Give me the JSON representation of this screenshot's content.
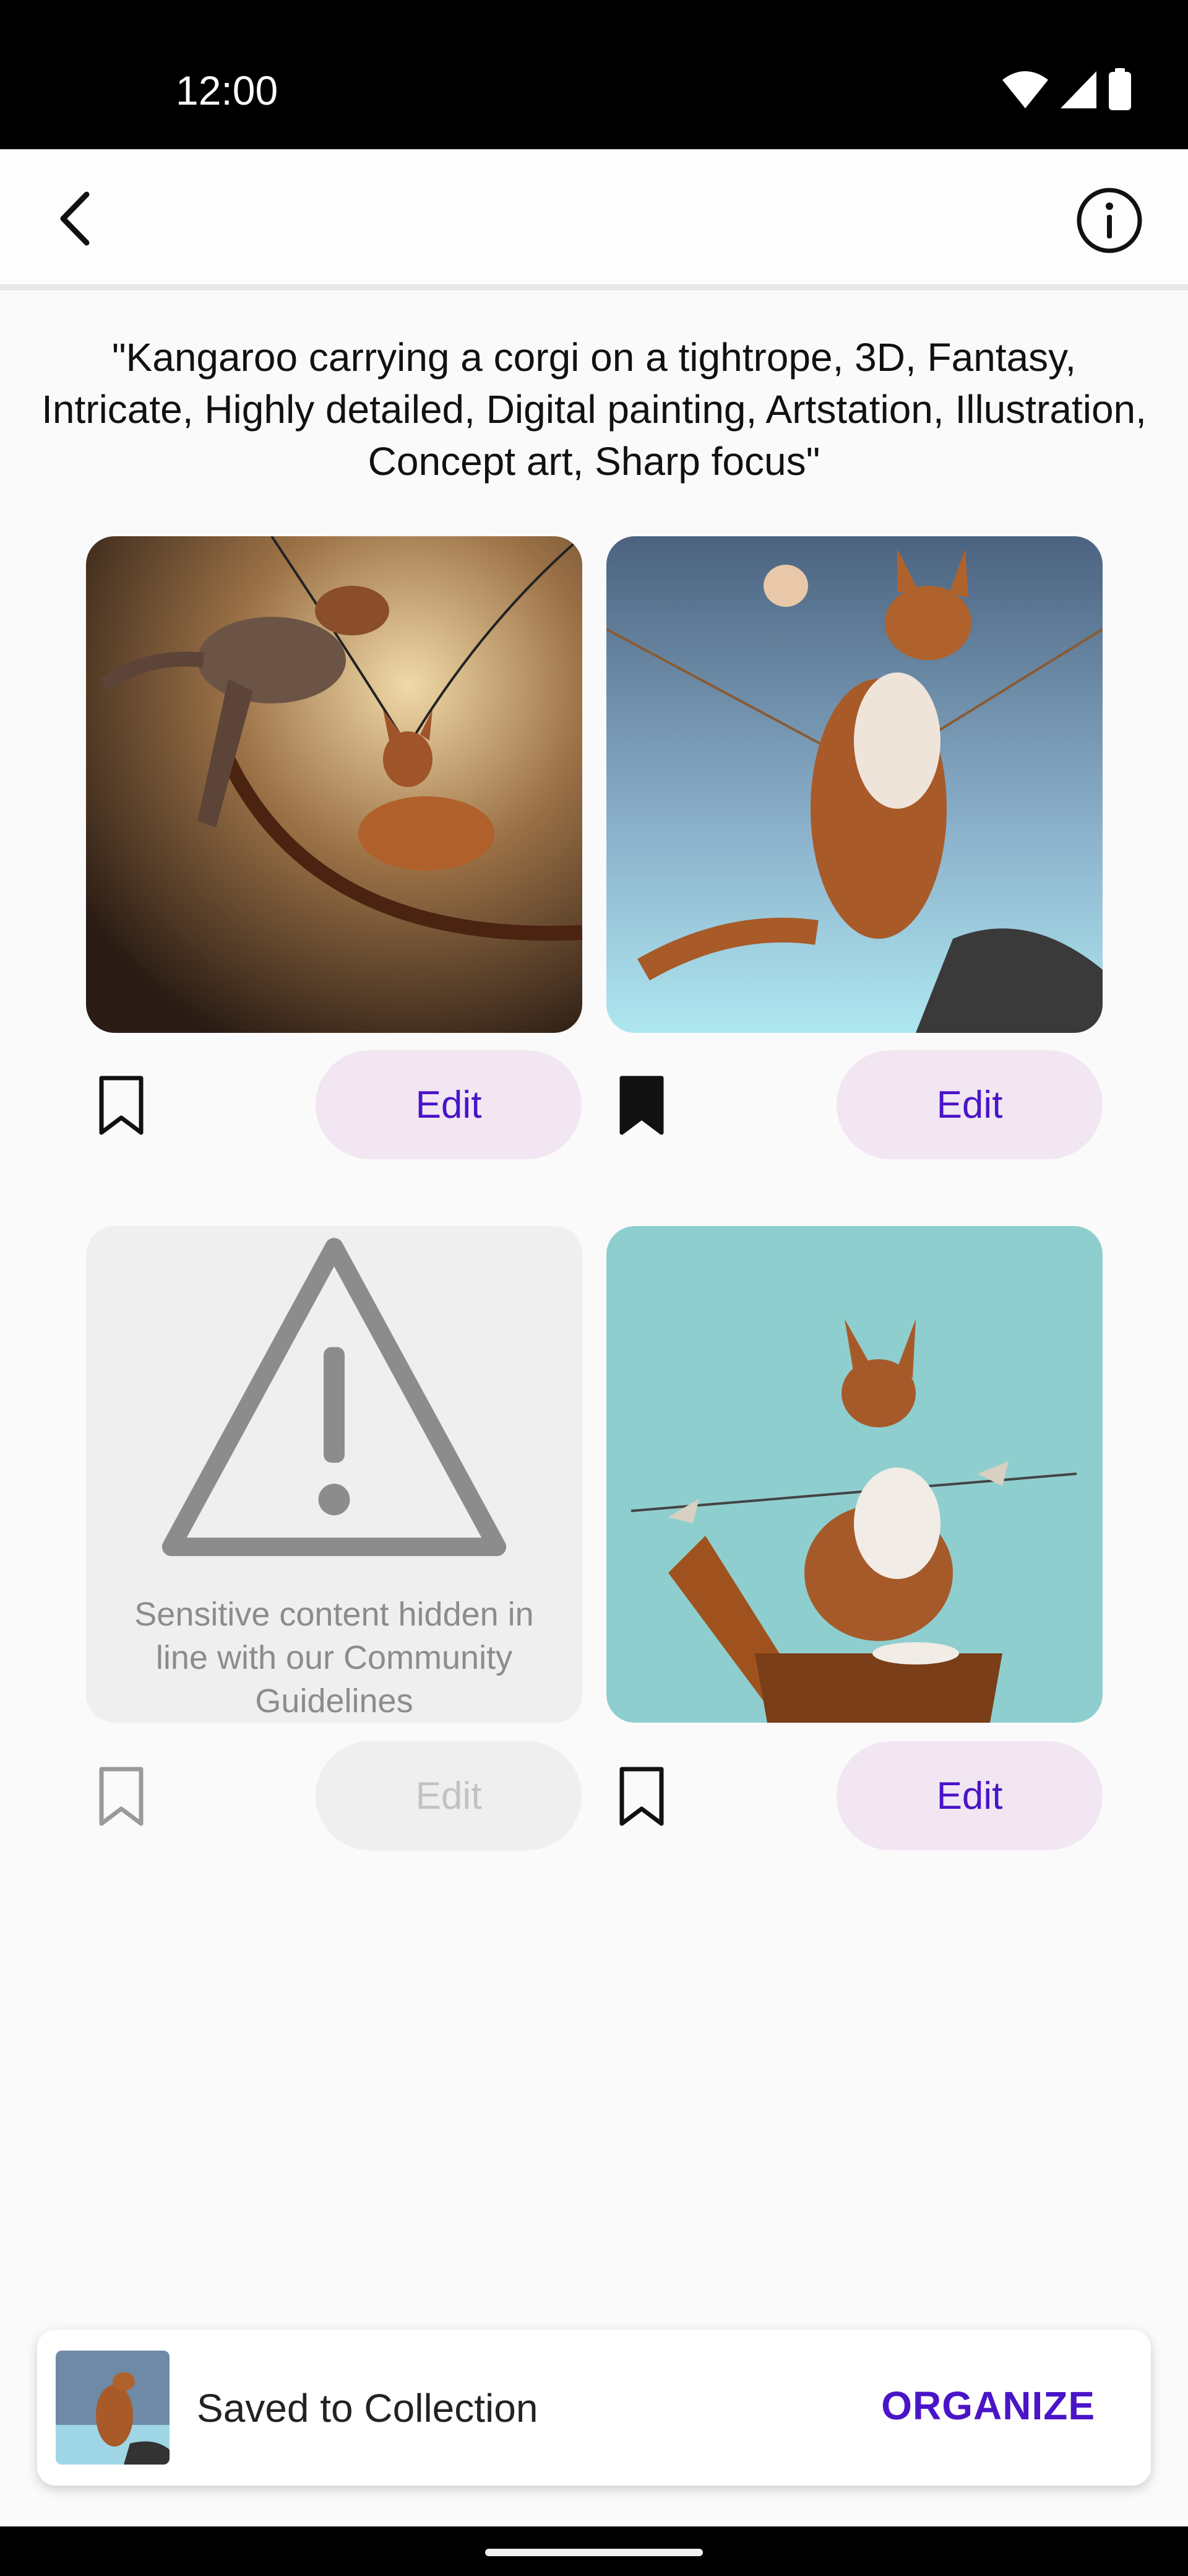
{
  "status_bar": {
    "time": "12:00"
  },
  "header": {
    "back_icon": "chevron-left-icon",
    "info_icon": "info-icon"
  },
  "prompt": "\"Kangaroo carrying a corgi on a tightrope, 3D, Fantasy, Intricate, Highly detailed, Digital painting, Artstation, Illustration, Concept art, Sharp focus\"",
  "images": [
    {
      "id": 1,
      "bookmarked": false,
      "edit_label": "Edit",
      "hidden": false
    },
    {
      "id": 2,
      "bookmarked": true,
      "edit_label": "Edit",
      "hidden": false
    },
    {
      "id": 3,
      "bookmarked": false,
      "edit_label": "Edit",
      "hidden": true,
      "hidden_message": "Sensitive content hidden in line with our Community Guidelines"
    },
    {
      "id": 4,
      "bookmarked": false,
      "edit_label": "Edit",
      "hidden": false
    }
  ],
  "snackbar": {
    "message": "Saved to Collection",
    "action": "ORGANIZE"
  },
  "colors": {
    "accent": "#4a14c8",
    "button_bg": "#f1e6f1",
    "disabled_bg": "#efefef"
  }
}
